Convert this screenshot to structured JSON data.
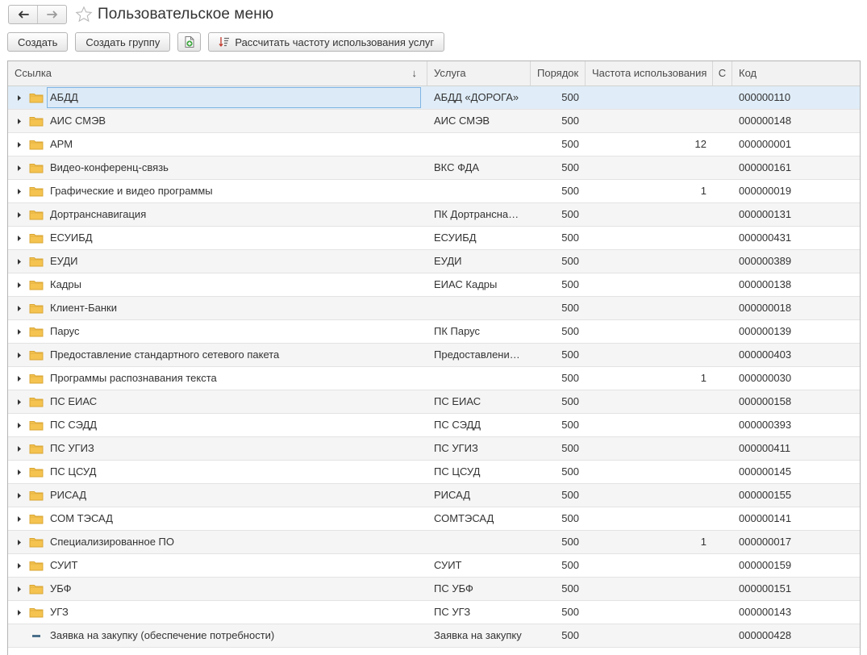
{
  "window": {
    "title": "Пользовательское меню"
  },
  "toolbar": {
    "create_label": "Создать",
    "create_group_label": "Создать группу",
    "calc_label": "Рассчитать частоту использования услуг"
  },
  "table": {
    "headers": {
      "link": "Ссылка",
      "service": "Услуга",
      "order": "Порядок",
      "frequency": "Частота использования",
      "c": "С",
      "code": "Код"
    },
    "sort_indicator": "↓",
    "rows": [
      {
        "link": "АБДД",
        "service": "АБДД «ДОРОГА»",
        "order": "500",
        "freq": "",
        "c": "",
        "code": "000000110",
        "type": "folder",
        "selected": true
      },
      {
        "link": "АИС СМЭВ",
        "service": "АИС СМЭВ",
        "order": "500",
        "freq": "",
        "c": "",
        "code": "000000148",
        "type": "folder"
      },
      {
        "link": "АРМ",
        "service": "",
        "order": "500",
        "freq": "12",
        "c": "",
        "code": "000000001",
        "type": "folder"
      },
      {
        "link": "Видео-конференц-связь",
        "service": "ВКС ФДА",
        "order": "500",
        "freq": "",
        "c": "",
        "code": "000000161",
        "type": "folder"
      },
      {
        "link": "Графические и видео программы",
        "service": "",
        "order": "500",
        "freq": "1",
        "c": "",
        "code": "000000019",
        "type": "folder"
      },
      {
        "link": "Дортранснавигация",
        "service": "ПК Дортранснавигация",
        "order": "500",
        "freq": "",
        "c": "",
        "code": "000000131",
        "type": "folder"
      },
      {
        "link": "ЕСУИБД",
        "service": "ЕСУИБД",
        "order": "500",
        "freq": "",
        "c": "",
        "code": "000000431",
        "type": "folder"
      },
      {
        "link": "ЕУДИ",
        "service": "ЕУДИ",
        "order": "500",
        "freq": "",
        "c": "",
        "code": "000000389",
        "type": "folder"
      },
      {
        "link": "Кадры",
        "service": "ЕИАС Кадры",
        "order": "500",
        "freq": "",
        "c": "",
        "code": "000000138",
        "type": "folder"
      },
      {
        "link": "Клиент-Банки",
        "service": "",
        "order": "500",
        "freq": "",
        "c": "",
        "code": "000000018",
        "type": "folder"
      },
      {
        "link": "Парус",
        "service": "ПК Парус",
        "order": "500",
        "freq": "",
        "c": "",
        "code": "000000139",
        "type": "folder"
      },
      {
        "link": "Предоставление стандартного сетевого пакета",
        "service": "Предоставление стандартного сетевого пакета",
        "order": "500",
        "freq": "",
        "c": "",
        "code": "000000403",
        "type": "folder"
      },
      {
        "link": "Программы распознавания текста",
        "service": "",
        "order": "500",
        "freq": "1",
        "c": "",
        "code": "000000030",
        "type": "folder"
      },
      {
        "link": "ПС ЕИАС",
        "service": "ПС ЕИАС",
        "order": "500",
        "freq": "",
        "c": "",
        "code": "000000158",
        "type": "folder"
      },
      {
        "link": "ПС СЭДД",
        "service": "ПС СЭДД",
        "order": "500",
        "freq": "",
        "c": "",
        "code": "000000393",
        "type": "folder"
      },
      {
        "link": "ПС УГИЗ",
        "service": "ПС УГИЗ",
        "order": "500",
        "freq": "",
        "c": "",
        "code": "000000411",
        "type": "folder"
      },
      {
        "link": "ПС ЦСУД",
        "service": "ПС ЦСУД",
        "order": "500",
        "freq": "",
        "c": "",
        "code": "000000145",
        "type": "folder"
      },
      {
        "link": "РИСАД",
        "service": "РИСАД",
        "order": "500",
        "freq": "",
        "c": "",
        "code": "000000155",
        "type": "folder"
      },
      {
        "link": "СОМ ТЭСАД",
        "service": "СОМТЭСАД",
        "order": "500",
        "freq": "",
        "c": "",
        "code": "000000141",
        "type": "folder"
      },
      {
        "link": "Специализированное ПО",
        "service": "",
        "order": "500",
        "freq": "1",
        "c": "",
        "code": "000000017",
        "type": "folder"
      },
      {
        "link": "СУИТ",
        "service": "СУИТ",
        "order": "500",
        "freq": "",
        "c": "",
        "code": "000000159",
        "type": "folder"
      },
      {
        "link": "УБФ",
        "service": "ПС УБФ",
        "order": "500",
        "freq": "",
        "c": "",
        "code": "000000151",
        "type": "folder"
      },
      {
        "link": "УГЗ",
        "service": "ПС УГЗ",
        "order": "500",
        "freq": "",
        "c": "",
        "code": "000000143",
        "type": "folder"
      },
      {
        "link": "Заявка на закупку (обеспечение потребности)",
        "service": "Заявка на закупку",
        "order": "500",
        "freq": "",
        "c": "",
        "code": "000000428",
        "type": "item"
      }
    ]
  },
  "colors": {
    "folder": "#f4c350",
    "selected_row": "#e0edf8",
    "header_bg": "#f2f2f2"
  }
}
